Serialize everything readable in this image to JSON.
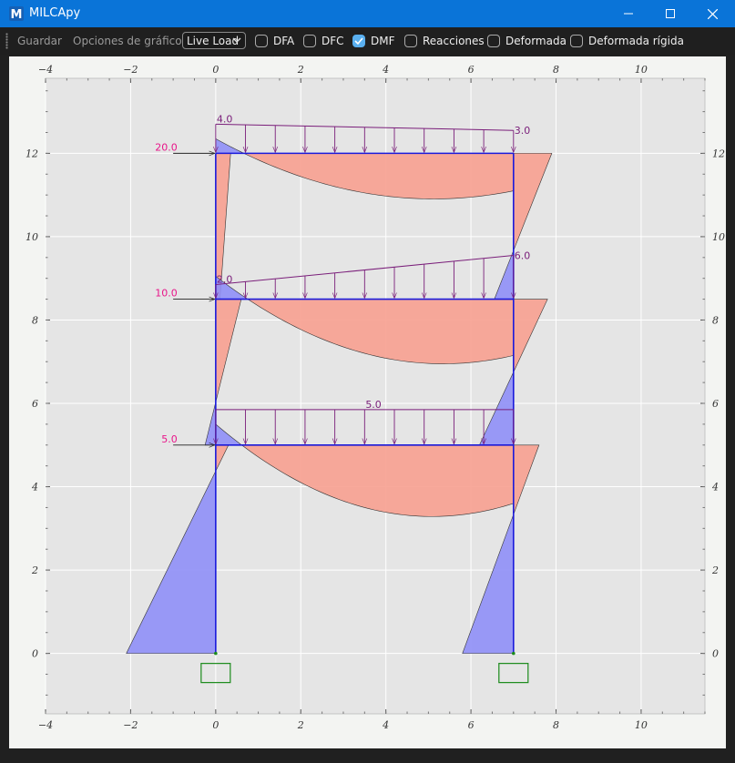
{
  "window": {
    "title": "MILCApy"
  },
  "toolbar": {
    "save_label": "Guardar",
    "chart_options_label": "Opciones de gráfico",
    "load_case": "Live Load",
    "checkboxes": [
      {
        "label": "DFA",
        "checked": false
      },
      {
        "label": "DFC",
        "checked": false
      },
      {
        "label": "DMF",
        "checked": true
      },
      {
        "label": "Reacciones",
        "checked": false
      },
      {
        "label": "Deformada",
        "checked": false
      },
      {
        "label": "Deformada rígida",
        "checked": false
      }
    ]
  },
  "colors": {
    "accent": "#0a74d8",
    "frame": "#1a1adc",
    "moment_positive": "#f7a090",
    "moment_negative": "#8f8ff7",
    "load": "#7a1e7a",
    "lateral_load_label": "#e8168a",
    "support": "#1a8a1a",
    "plot_bg": "#e5e5e5"
  },
  "chart_data": {
    "type": "structural-frame",
    "xlim": [
      -4.0,
      11.5
    ],
    "ylim": [
      -1.45,
      13.8
    ],
    "xticks": [
      -4,
      -2,
      0,
      2,
      4,
      6,
      8,
      10
    ],
    "yticks": [
      0,
      2,
      4,
      6,
      8,
      10,
      12
    ],
    "grid": true,
    "nodes": [
      [
        0,
        0
      ],
      [
        7,
        0
      ],
      [
        0,
        5
      ],
      [
        7,
        5
      ],
      [
        0,
        8.5
      ],
      [
        7,
        8.5
      ],
      [
        0,
        12
      ],
      [
        7,
        12
      ]
    ],
    "members": [
      [
        0,
        2
      ],
      [
        2,
        4
      ],
      [
        4,
        6
      ],
      [
        1,
        3
      ],
      [
        3,
        5
      ],
      [
        5,
        7
      ],
      [
        2,
        3
      ],
      [
        4,
        5
      ],
      [
        6,
        7
      ]
    ],
    "supports": [
      [
        0,
        0
      ],
      [
        7,
        0
      ]
    ],
    "lateral_loads": [
      {
        "y": 12,
        "value": "20.0"
      },
      {
        "y": 8.5,
        "value": "10.0"
      },
      {
        "y": 5,
        "value": "5.0"
      }
    ],
    "distributed_loads": [
      {
        "y": 12,
        "left_label": "4.0",
        "right_label": "3.0",
        "left_height": 0.7,
        "right_height": 0.55
      },
      {
        "y": 8.5,
        "left_label": "2.0",
        "right_label": "6.0",
        "left_height": 0.35,
        "right_height": 1.05
      },
      {
        "y": 5,
        "center_label": "5.0",
        "left_height": 0.85,
        "right_height": 0.85
      }
    ],
    "moment_diagrams": [
      {
        "element": "col-left-1",
        "base": [
          0,
          0
        ],
        "tip": [
          0,
          5
        ],
        "poly": [
          [
            0,
            0
          ],
          [
            -2.1,
            0
          ],
          [
            0.3,
            5
          ],
          [
            0,
            5
          ]
        ],
        "sign": "negative"
      },
      {
        "element": "col-right-1",
        "base": [
          7,
          0
        ],
        "tip": [
          7,
          5
        ],
        "poly": [
          [
            7,
            0
          ],
          [
            5.8,
            0
          ],
          [
            7.6,
            5
          ],
          [
            7,
            5
          ]
        ],
        "sign": "mixed"
      },
      {
        "element": "col-left-2",
        "poly": [
          [
            0,
            5
          ],
          [
            -0.25,
            5
          ],
          [
            0.6,
            8.5
          ],
          [
            0,
            8.5
          ]
        ],
        "sign": "mixed"
      },
      {
        "element": "col-right-2",
        "poly": [
          [
            7,
            5
          ],
          [
            6.2,
            5
          ],
          [
            7.8,
            8.5
          ],
          [
            7,
            8.5
          ]
        ],
        "sign": "mixed"
      },
      {
        "element": "col-left-3",
        "poly": [
          [
            0,
            8.5
          ],
          [
            0.1,
            8.5
          ],
          [
            0.35,
            12
          ],
          [
            0,
            12
          ]
        ],
        "sign": "positive"
      },
      {
        "element": "col-right-3",
        "poly": [
          [
            7,
            8.5
          ],
          [
            6.55,
            8.5
          ],
          [
            7.9,
            12
          ],
          [
            7,
            12
          ]
        ],
        "sign": "mixed"
      },
      {
        "element": "beam-1",
        "y": 5,
        "left": -0.5,
        "mid_sag": 0.6,
        "right": 1.4
      },
      {
        "element": "beam-2",
        "y": 8.5,
        "left": -0.55,
        "mid_sag": 0.5,
        "right": 1.35
      },
      {
        "element": "beam-3",
        "y": 12,
        "left": -0.35,
        "mid_sag": 0.4,
        "right": 0.9
      }
    ]
  }
}
